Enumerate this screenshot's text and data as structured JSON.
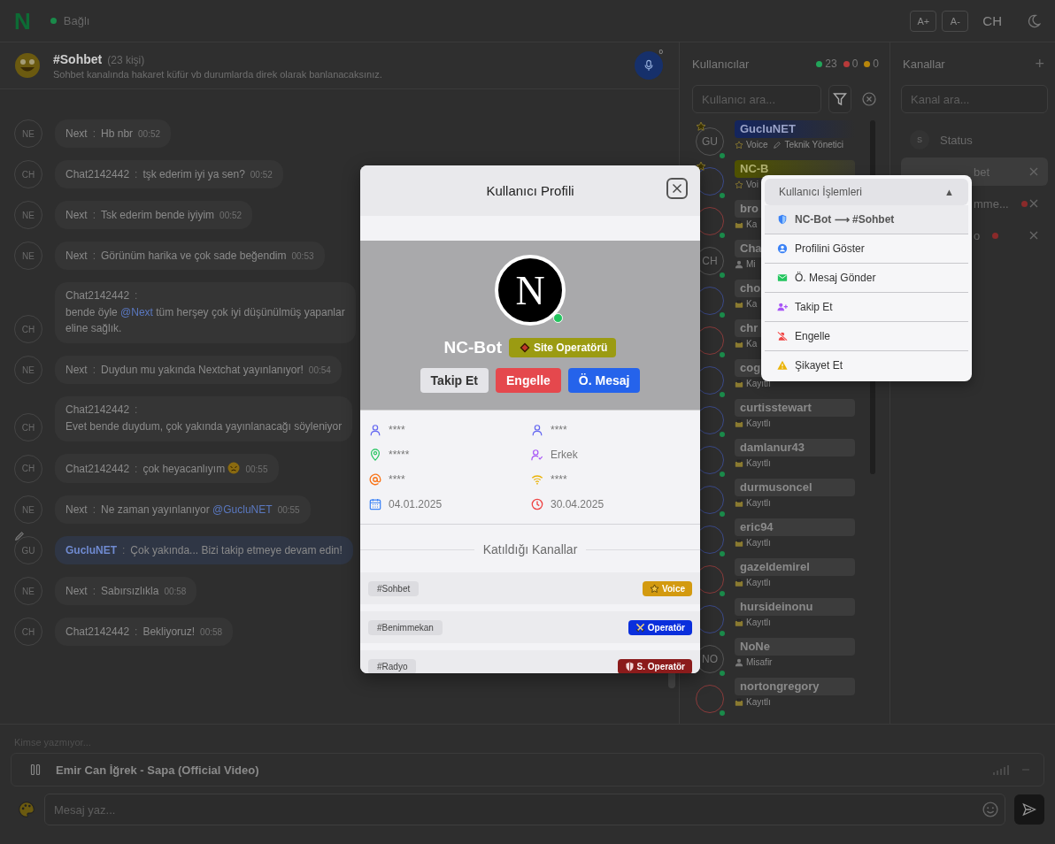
{
  "topbar": {
    "logo": "N",
    "online": true,
    "status": "Bağlı",
    "buttons": [
      "A+",
      "A-"
    ],
    "user_initials": "CH"
  },
  "channel_header": {
    "name": "#Sohbet",
    "count": "(23 kişi)",
    "topic": "Sohbet kanalında hakaret küfür vb durumlarda direk olarak banlanacaksınız.",
    "mic_badge": "0"
  },
  "messages": [
    {
      "avatar": "NE",
      "author": "Next",
      "sep": ":",
      "kind": "inline",
      "highlight": false,
      "lines": [
        [
          {
            "kind": "text",
            "text": "Hb nbr"
          }
        ]
      ],
      "time": "00:52"
    },
    {
      "avatar": "CH",
      "author": "Chat2142442",
      "sep": ":",
      "kind": "inline",
      "highlight": false,
      "lines": [
        [
          {
            "kind": "text",
            "text": "tşk ederim iyi ya sen?"
          }
        ]
      ],
      "time": "00:52"
    },
    {
      "avatar": "NE",
      "author": "Next",
      "sep": ":",
      "kind": "inline",
      "highlight": false,
      "lines": [
        [
          {
            "kind": "text",
            "text": "Tsk ederim bende iyiyim"
          }
        ]
      ],
      "time": "00:52"
    },
    {
      "avatar": "NE",
      "author": "Next",
      "sep": ":",
      "kind": "inline",
      "highlight": false,
      "lines": [
        [
          {
            "kind": "text",
            "text": "Görünüm harika ve çok sade beğendim"
          }
        ]
      ],
      "time": "00:53"
    },
    {
      "avatar": "CH",
      "author": "Chat2142442",
      "sep": ":",
      "kind": "block",
      "highlight": false,
      "lines": [
        [
          {
            "kind": "text",
            "text": "bende öyle "
          },
          {
            "kind": "mention",
            "text": "@Next"
          },
          {
            "kind": "text",
            "text": " tüm herşey çok iyi düşünülmüş yapanlar"
          }
        ],
        [
          {
            "kind": "text",
            "text": "eline sağlık."
          }
        ]
      ]
    },
    {
      "avatar": "NE",
      "author": "Next",
      "sep": ":",
      "kind": "inline",
      "highlight": false,
      "lines": [
        [
          {
            "kind": "text",
            "text": "Duydun mu yakında Nextchat yayınlanıyor!"
          }
        ]
      ],
      "time": "00:54"
    },
    {
      "avatar": "CH",
      "author": "Chat2142442",
      "sep": ":",
      "kind": "block",
      "highlight": false,
      "lines": [
        [
          {
            "kind": "text",
            "text": "Evet bende duydum, çok yakında yayınlanacağı söyleniyor"
          }
        ]
      ]
    },
    {
      "avatar": "CH",
      "author": "Chat2142442",
      "sep": ":",
      "kind": "inline",
      "highlight": false,
      "lines": [
        [
          {
            "kind": "text",
            "text": "çok heyacanlıyım "
          },
          {
            "kind": "emoji"
          }
        ]
      ],
      "time": "00:55"
    },
    {
      "avatar": "NE",
      "author": "Next",
      "sep": ":",
      "kind": "inline",
      "highlight": false,
      "lines": [
        [
          {
            "kind": "text",
            "text": "Ne zaman yayınlanıyor "
          },
          {
            "kind": "mention",
            "text": "@GucluNET"
          }
        ]
      ],
      "time": "00:55"
    },
    {
      "avatar": "GU",
      "author": "GucluNET",
      "sep": ":",
      "kind": "inline",
      "highlight": true,
      "lines": [
        [
          {
            "kind": "text",
            "text": "Çok yakında... Bizi takip etmeye devam edin!"
          }
        ]
      ]
    },
    {
      "avatar": "NE",
      "author": "Next",
      "sep": ":",
      "kind": "inline",
      "highlight": false,
      "lines": [
        [
          {
            "kind": "text",
            "text": "Sabırsızlıkla"
          }
        ]
      ],
      "time": "00:58"
    },
    {
      "avatar": "CH",
      "author": "Chat2142442",
      "sep": ":",
      "kind": "inline",
      "highlight": false,
      "lines": [
        [
          {
            "kind": "text",
            "text": "Bekliyoruz!"
          }
        ]
      ],
      "time": "00:58"
    }
  ],
  "users_panel": {
    "title": "Kullanıcılar",
    "counts": [
      {
        "value": "23",
        "color": "#22a55a"
      },
      {
        "value": "0",
        "color": "#b83a3a"
      },
      {
        "value": "0",
        "color": "#b8860b"
      }
    ],
    "search": {
      "placeholder": "Kullanıcı ara..."
    },
    "users": [
      {
        "name": "GucluNET",
        "kind": "admin",
        "initials": "GU",
        "star": true,
        "online": true,
        "color": "#555555",
        "tags": [
          {
            "kind": "voice",
            "text": "Voice"
          },
          {
            "kind": "tech",
            "text": "Teknik Yönetici"
          }
        ]
      },
      {
        "name": "NC-B",
        "kind": "bot",
        "star": true,
        "online": true,
        "color": "#3b4a8a",
        "tags": [
          {
            "kind": "voice",
            "text": "Voi"
          }
        ]
      },
      {
        "name": "bro",
        "kind": "member",
        "online": true,
        "color": "#8a3b3b",
        "tags": [
          {
            "kind": "registered",
            "text": "Ka"
          }
        ]
      },
      {
        "name": "Cha",
        "kind": "member",
        "initials": "CH",
        "online": true,
        "color": "#555555",
        "tags": [
          {
            "kind": "guest",
            "text": "Mi"
          }
        ]
      },
      {
        "name": "cho",
        "kind": "member",
        "online": true,
        "color": "#3b4a8a",
        "tags": [
          {
            "kind": "registered",
            "text": "Ka"
          }
        ]
      },
      {
        "name": "chr",
        "kind": "member",
        "online": true,
        "color": "#8a3b3b",
        "tags": [
          {
            "kind": "registered",
            "text": "Ka"
          }
        ]
      },
      {
        "name": "cog",
        "kind": "member",
        "online": true,
        "color": "#3b4a8a",
        "tags": [
          {
            "kind": "registered",
            "text": "Kayıtlı"
          }
        ]
      },
      {
        "name": "curtisstewart",
        "kind": "member",
        "online": true,
        "color": "#3b4a8a",
        "tags": [
          {
            "kind": "registered",
            "text": "Kayıtlı"
          }
        ]
      },
      {
        "name": "damlanur43",
        "kind": "member",
        "online": true,
        "color": "#3b4a8a",
        "tags": [
          {
            "kind": "registered",
            "text": "Kayıtlı"
          }
        ]
      },
      {
        "name": "durmusoncel",
        "kind": "member",
        "online": true,
        "color": "#3b4a8a",
        "tags": [
          {
            "kind": "registered",
            "text": "Kayıtlı"
          }
        ]
      },
      {
        "name": "eric94",
        "kind": "member",
        "online": true,
        "color": "#3b4a8a",
        "tags": [
          {
            "kind": "registered",
            "text": "Kayıtlı"
          }
        ]
      },
      {
        "name": "gazeldemirel",
        "kind": "member",
        "online": true,
        "color": "#8a3b3b",
        "tags": [
          {
            "kind": "registered",
            "text": "Kayıtlı"
          }
        ]
      },
      {
        "name": "hursideinonu",
        "kind": "member",
        "online": true,
        "color": "#3b4a8a",
        "tags": [
          {
            "kind": "registered",
            "text": "Kayıtlı"
          }
        ]
      },
      {
        "name": "NoNe",
        "kind": "member",
        "initials": "NO",
        "online": true,
        "color": "#555555",
        "tags": [
          {
            "kind": "guest",
            "text": "Misafir"
          }
        ]
      },
      {
        "name": "nortongregory",
        "kind": "member",
        "online": true,
        "color": "#8a3b3b",
        "tags": [
          {
            "kind": "registered",
            "text": "Kayıtlı"
          }
        ]
      }
    ]
  },
  "channels_panel": {
    "title": "Kanallar",
    "add": "+",
    "search": {
      "placeholder": "Kanal ara..."
    },
    "channels": [
      {
        "kind": "status",
        "initial": "S",
        "name": "Status"
      },
      {
        "kind": "channel",
        "name": "bet",
        "unread": false,
        "selected": true
      },
      {
        "kind": "channel",
        "name": "mme...",
        "unread": true,
        "selected": false
      },
      {
        "kind": "channel",
        "name": "o",
        "unread": true,
        "selected": false
      }
    ]
  },
  "composer": {
    "typing": "Kimse yazmıyor...",
    "player": {
      "playing": true,
      "title": "Emir Can İğrek - Sapa (Official Video)"
    },
    "input": {
      "placeholder": "Mesaj yaz..."
    }
  },
  "profile_modal": {
    "title": "Kullanıcı Profili",
    "avatar_logo": "N",
    "online": true,
    "name": "NC-Bot",
    "rank": {
      "kind": "site_operator",
      "text": "Site Operatörü"
    },
    "actions": [
      {
        "kind": "follow",
        "label": "Takip Et"
      },
      {
        "kind": "block",
        "label": "Engelle"
      },
      {
        "kind": "message",
        "label": "Ö. Mesaj"
      }
    ],
    "info": [
      {
        "kind": "name",
        "text": "****"
      },
      {
        "kind": "surname",
        "text": "****"
      },
      {
        "kind": "location",
        "text": "*****"
      },
      {
        "kind": "gender",
        "text": "Erkek"
      },
      {
        "kind": "email",
        "text": "****"
      },
      {
        "kind": "ip",
        "text": "****"
      },
      {
        "kind": "joined",
        "text": "04.01.2025"
      },
      {
        "kind": "last_seen",
        "text": "30.04.2025"
      }
    ],
    "channels_title": "Katıldığı Kanallar",
    "channels": [
      {
        "name": "#Sohbet",
        "role": {
          "kind": "voice",
          "text": "Voice"
        }
      },
      {
        "name": "#Benimmekan",
        "role": {
          "kind": "operator",
          "text": "Operatör"
        }
      },
      {
        "name": "#Radyo",
        "role": {
          "kind": "super_operator",
          "text": "S. Operatör"
        }
      }
    ]
  },
  "context_menu": {
    "header": "Kullanıcı İşlemleri",
    "caret": "▲",
    "items": [
      {
        "kind": "target",
        "text": "NC-Bot ⟶ #Sohbet"
      },
      {
        "kind": "profile",
        "text": "Profilini Göster"
      },
      {
        "kind": "message",
        "text": "Ö. Mesaj Gönder"
      },
      {
        "kind": "follow",
        "text": "Takip Et"
      },
      {
        "kind": "block",
        "text": "Engelle"
      },
      {
        "kind": "report",
        "text": "Şikayet Et"
      }
    ]
  }
}
